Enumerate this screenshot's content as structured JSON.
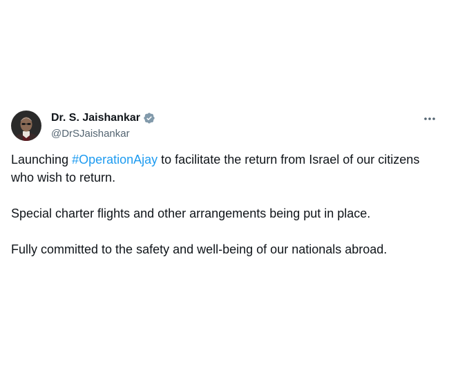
{
  "author": {
    "display_name": "Dr. S. Jaishankar",
    "handle": "@DrSJaishankar",
    "verified_icon": "verified-badge-icon",
    "verified_color": "#829aab"
  },
  "menu": {
    "icon": "more-options-icon"
  },
  "tweet": {
    "p1_before": "Launching ",
    "p1_hashtag": "#OperationAjay",
    "p1_after": " to facilitate the return from Israel of our citizens who wish to return.",
    "p2": "Special charter flights and other arrangements being put in place.",
    "p3": "Fully committed to the safety and well-being of our nationals abroad."
  },
  "colors": {
    "hashtag": "#1d9bf0",
    "text": "#0f1419",
    "secondary": "#536471"
  }
}
